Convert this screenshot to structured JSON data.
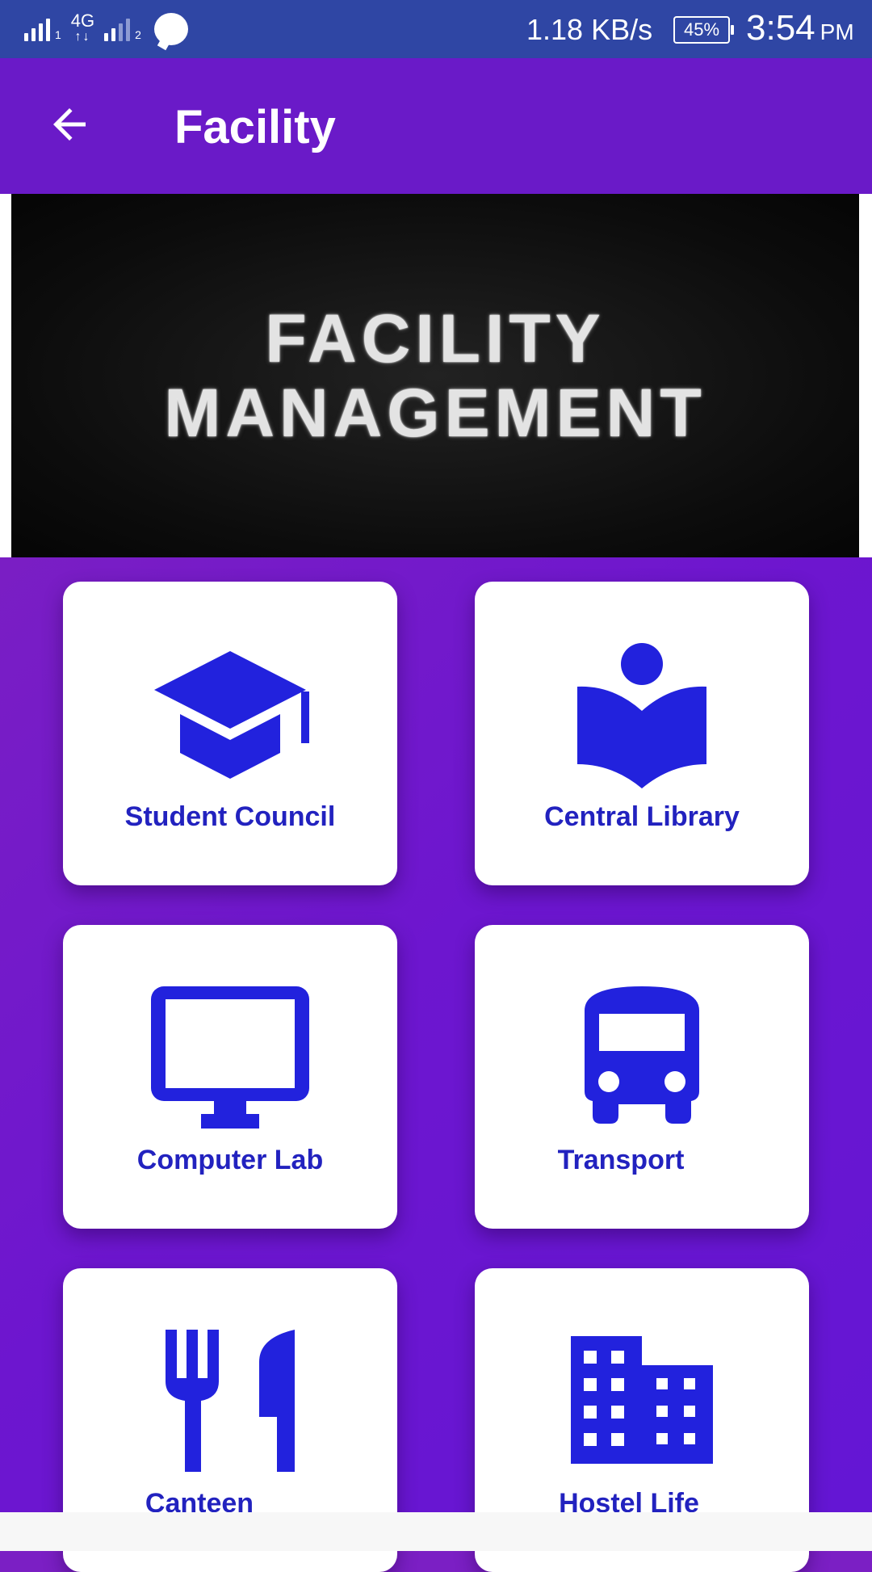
{
  "status_bar": {
    "sim1_label": "1",
    "network_type": "4G",
    "sim2_label": "2",
    "data_speed": "1.18 KB/s",
    "battery_percent": "45%",
    "time": "3:54",
    "time_suffix": "PM"
  },
  "app_bar": {
    "title": "Facility",
    "back_icon": "arrow-left-icon"
  },
  "banner": {
    "line1": "FACILITY",
    "line2": "MANAGEMENT"
  },
  "colors": {
    "accent": "#2222bf",
    "app_bar": "#6a1ac8",
    "status_bar": "#2f46a4",
    "background": "#7b1fc4"
  },
  "facilities": [
    {
      "label": "Student Council",
      "icon": "graduation-cap-icon"
    },
    {
      "label": "Central Library",
      "icon": "reading-book-icon"
    },
    {
      "label": "Computer Lab",
      "icon": "monitor-icon"
    },
    {
      "label": "Transport",
      "icon": "bus-icon"
    },
    {
      "label": "Canteen",
      "icon": "fork-knife-icon"
    },
    {
      "label": "Hostel Life",
      "icon": "building-icon"
    }
  ]
}
